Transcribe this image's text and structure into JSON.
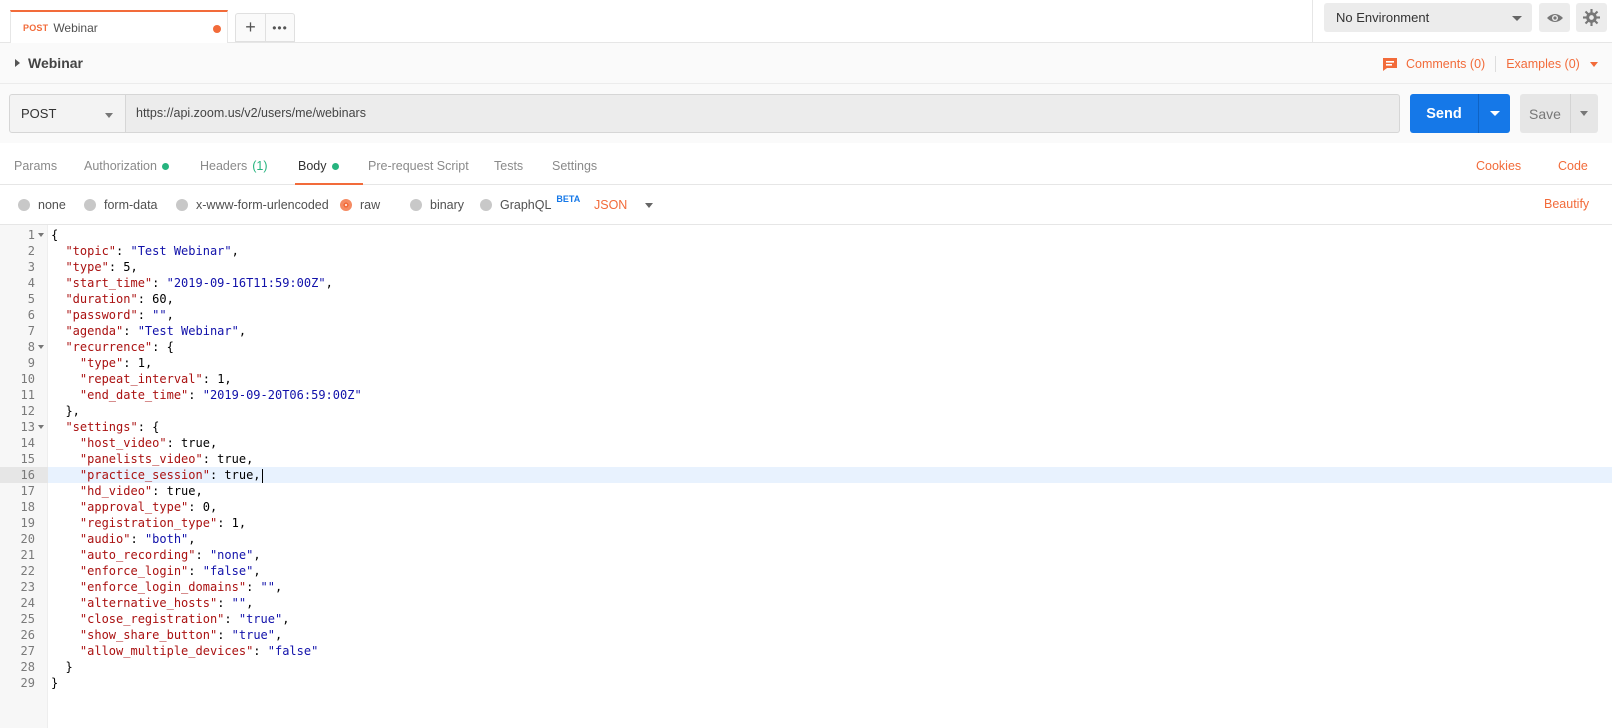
{
  "tab": {
    "method": "POST",
    "name": "Webinar"
  },
  "environment": {
    "selected": "No Environment"
  },
  "breadcrumb": {
    "title": "Webinar",
    "comments": "Comments (0)",
    "examples": "Examples (0)"
  },
  "request": {
    "method": "POST",
    "url": "https://api.zoom.us/v2/users/me/webinars",
    "send_label": "Send",
    "save_label": "Save"
  },
  "subtabs": [
    {
      "label": "Params"
    },
    {
      "label": "Authorization"
    },
    {
      "label": "Headers",
      "count": "(1)"
    },
    {
      "label": "Body"
    },
    {
      "label": "Pre-request Script"
    },
    {
      "label": "Tests"
    },
    {
      "label": "Settings"
    }
  ],
  "links": {
    "cookies": "Cookies",
    "code": "Code"
  },
  "body_types": {
    "none": "none",
    "form_data": "form-data",
    "urlencoded": "x-www-form-urlencoded",
    "raw": "raw",
    "binary": "binary",
    "graphql": "GraphQL",
    "beta": "BETA",
    "format": "JSON",
    "beautify": "Beautify"
  },
  "colors": {
    "accent": "#f26b3a",
    "send": "#1578e8",
    "green": "#26b47f"
  },
  "editor": {
    "active_line": 16,
    "lines": [
      {
        "n": "1",
        "fold": true,
        "t": [
          [
            "p",
            "{"
          ]
        ]
      },
      {
        "n": "2",
        "t": [
          [
            "p",
            "  "
          ],
          [
            "k",
            "\"topic\""
          ],
          [
            "p",
            ": "
          ],
          [
            "s",
            "\"Test Webinar\""
          ],
          [
            "p",
            ","
          ]
        ]
      },
      {
        "n": "3",
        "t": [
          [
            "p",
            "  "
          ],
          [
            "k",
            "\"type\""
          ],
          [
            "p",
            ": "
          ],
          [
            "v",
            "5"
          ],
          [
            "p",
            ","
          ]
        ]
      },
      {
        "n": "4",
        "t": [
          [
            "p",
            "  "
          ],
          [
            "k",
            "\"start_time\""
          ],
          [
            "p",
            ": "
          ],
          [
            "s",
            "\"2019-09-16T11:59:00Z\""
          ],
          [
            "p",
            ","
          ]
        ]
      },
      {
        "n": "5",
        "t": [
          [
            "p",
            "  "
          ],
          [
            "k",
            "\"duration\""
          ],
          [
            "p",
            ": "
          ],
          [
            "v",
            "60"
          ],
          [
            "p",
            ","
          ]
        ]
      },
      {
        "n": "6",
        "t": [
          [
            "p",
            "  "
          ],
          [
            "k",
            "\"password\""
          ],
          [
            "p",
            ": "
          ],
          [
            "s",
            "\"\""
          ],
          [
            "p",
            ","
          ]
        ]
      },
      {
        "n": "7",
        "t": [
          [
            "p",
            "  "
          ],
          [
            "k",
            "\"agenda\""
          ],
          [
            "p",
            ": "
          ],
          [
            "s",
            "\"Test Webinar\""
          ],
          [
            "p",
            ","
          ]
        ]
      },
      {
        "n": "8",
        "fold": true,
        "t": [
          [
            "p",
            "  "
          ],
          [
            "k",
            "\"recurrence\""
          ],
          [
            "p",
            ": {"
          ]
        ]
      },
      {
        "n": "9",
        "t": [
          [
            "p",
            "    "
          ],
          [
            "k",
            "\"type\""
          ],
          [
            "p",
            ": "
          ],
          [
            "v",
            "1"
          ],
          [
            "p",
            ","
          ]
        ]
      },
      {
        "n": "10",
        "t": [
          [
            "p",
            "    "
          ],
          [
            "k",
            "\"repeat_interval\""
          ],
          [
            "p",
            ": "
          ],
          [
            "v",
            "1"
          ],
          [
            "p",
            ","
          ]
        ]
      },
      {
        "n": "11",
        "t": [
          [
            "p",
            "    "
          ],
          [
            "k",
            "\"end_date_time\""
          ],
          [
            "p",
            ": "
          ],
          [
            "s",
            "\"2019-09-20T06:59:00Z\""
          ]
        ]
      },
      {
        "n": "12",
        "t": [
          [
            "p",
            "  },"
          ]
        ]
      },
      {
        "n": "13",
        "fold": true,
        "t": [
          [
            "p",
            "  "
          ],
          [
            "k",
            "\"settings\""
          ],
          [
            "p",
            ": {"
          ]
        ]
      },
      {
        "n": "14",
        "t": [
          [
            "p",
            "    "
          ],
          [
            "k",
            "\"host_video\""
          ],
          [
            "p",
            ": true,"
          ]
        ]
      },
      {
        "n": "15",
        "t": [
          [
            "p",
            "    "
          ],
          [
            "k",
            "\"panelists_video\""
          ],
          [
            "p",
            ": true,"
          ]
        ]
      },
      {
        "n": "16",
        "t": [
          [
            "p",
            "    "
          ],
          [
            "k",
            "\"practice_session\""
          ],
          [
            "p",
            ": true,"
          ]
        ]
      },
      {
        "n": "17",
        "t": [
          [
            "p",
            "    "
          ],
          [
            "k",
            "\"hd_video\""
          ],
          [
            "p",
            ": true,"
          ]
        ]
      },
      {
        "n": "18",
        "t": [
          [
            "p",
            "    "
          ],
          [
            "k",
            "\"approval_type\""
          ],
          [
            "p",
            ": "
          ],
          [
            "v",
            "0"
          ],
          [
            "p",
            ","
          ]
        ]
      },
      {
        "n": "19",
        "t": [
          [
            "p",
            "    "
          ],
          [
            "k",
            "\"registration_type\""
          ],
          [
            "p",
            ": "
          ],
          [
            "v",
            "1"
          ],
          [
            "p",
            ","
          ]
        ]
      },
      {
        "n": "20",
        "t": [
          [
            "p",
            "    "
          ],
          [
            "k",
            "\"audio\""
          ],
          [
            "p",
            ": "
          ],
          [
            "s",
            "\"both\""
          ],
          [
            "p",
            ","
          ]
        ]
      },
      {
        "n": "21",
        "t": [
          [
            "p",
            "    "
          ],
          [
            "k",
            "\"auto_recording\""
          ],
          [
            "p",
            ": "
          ],
          [
            "s",
            "\"none\""
          ],
          [
            "p",
            ","
          ]
        ]
      },
      {
        "n": "22",
        "t": [
          [
            "p",
            "    "
          ],
          [
            "k",
            "\"enforce_login\""
          ],
          [
            "p",
            ": "
          ],
          [
            "s",
            "\"false\""
          ],
          [
            "p",
            ","
          ]
        ]
      },
      {
        "n": "23",
        "t": [
          [
            "p",
            "    "
          ],
          [
            "k",
            "\"enforce_login_domains\""
          ],
          [
            "p",
            ": "
          ],
          [
            "s",
            "\"\""
          ],
          [
            "p",
            ","
          ]
        ]
      },
      {
        "n": "24",
        "t": [
          [
            "p",
            "    "
          ],
          [
            "k",
            "\"alternative_hosts\""
          ],
          [
            "p",
            ": "
          ],
          [
            "s",
            "\"\""
          ],
          [
            "p",
            ","
          ]
        ]
      },
      {
        "n": "25",
        "t": [
          [
            "p",
            "    "
          ],
          [
            "k",
            "\"close_registration\""
          ],
          [
            "p",
            ": "
          ],
          [
            "s",
            "\"true\""
          ],
          [
            "p",
            ","
          ]
        ]
      },
      {
        "n": "26",
        "t": [
          [
            "p",
            "    "
          ],
          [
            "k",
            "\"show_share_button\""
          ],
          [
            "p",
            ": "
          ],
          [
            "s",
            "\"true\""
          ],
          [
            "p",
            ","
          ]
        ]
      },
      {
        "n": "27",
        "t": [
          [
            "p",
            "    "
          ],
          [
            "k",
            "\"allow_multiple_devices\""
          ],
          [
            "p",
            ": "
          ],
          [
            "s",
            "\"false\""
          ]
        ]
      },
      {
        "n": "28",
        "t": [
          [
            "p",
            "  }"
          ]
        ]
      },
      {
        "n": "29",
        "t": [
          [
            "p",
            "}"
          ]
        ]
      }
    ]
  }
}
